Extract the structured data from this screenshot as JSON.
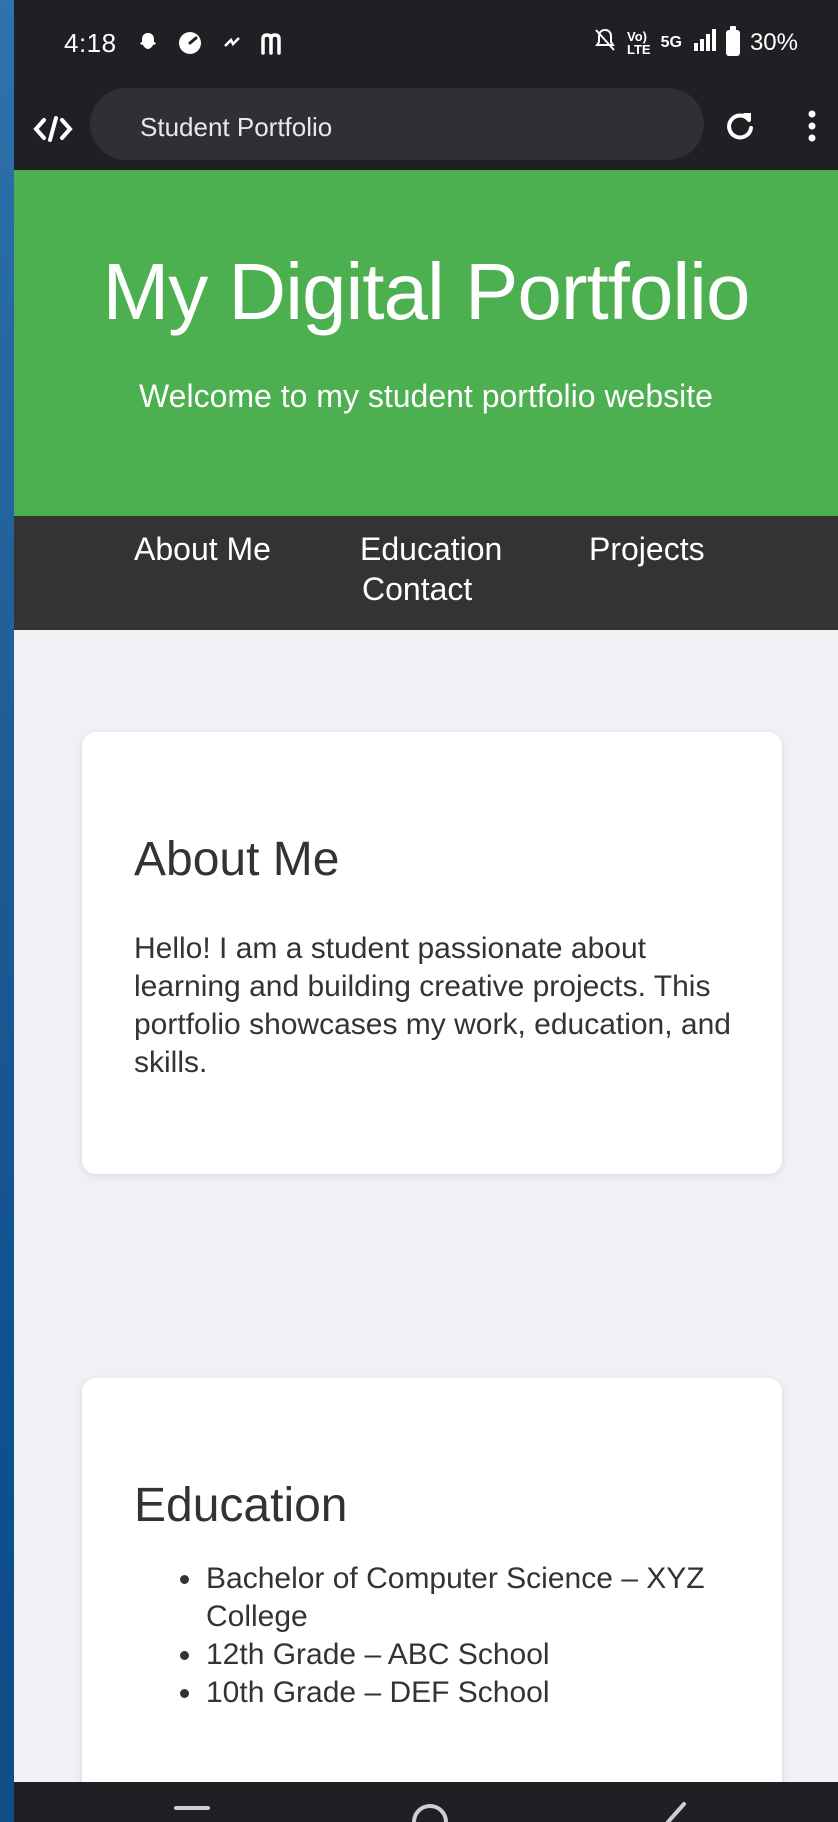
{
  "status_bar": {
    "time": "4:18",
    "battery": "30%",
    "network": "5G",
    "lte_label": "Vo)\nLTE",
    "left_icons": [
      "snapchat-icon",
      "speedometer-icon",
      "messenger-icon",
      "m-icon"
    ],
    "right_icons": [
      "mute-bell-icon",
      "signal-icon",
      "battery-icon"
    ]
  },
  "browser": {
    "url_text": "Student Portfolio",
    "logo_icon": "code-icon",
    "reload_icon": "reload-icon",
    "menu_icon": "more-vert-icon"
  },
  "hero": {
    "title": "My Digital Portfolio",
    "subtitle": "Welcome to my student portfolio website",
    "background_color": "#4caf50"
  },
  "nav": {
    "links": [
      "About Me",
      "Education",
      "Projects",
      "Contact"
    ],
    "background_color": "#333333"
  },
  "about": {
    "heading": "About Me",
    "text": "Hello! I am a student passionate about learning and building creative projects. This portfolio showcases my work, education, and skills."
  },
  "education": {
    "heading": "Education",
    "items": [
      "Bachelor of Computer Science – XYZ College",
      "12th Grade – ABC School",
      "10th Grade – DEF School"
    ]
  },
  "system_nav": {
    "icons": [
      "recents-icon",
      "home-icon",
      "back-icon"
    ]
  }
}
